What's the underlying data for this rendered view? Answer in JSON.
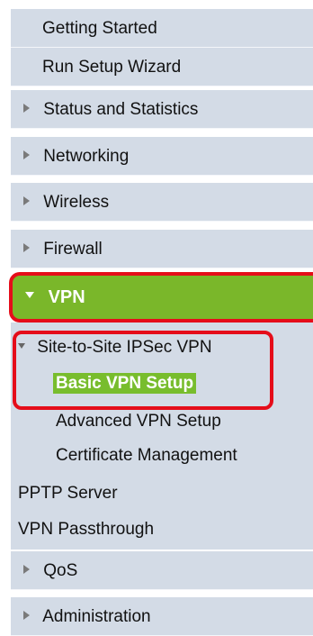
{
  "nav": {
    "items_top": [
      {
        "label": "Getting Started"
      },
      {
        "label": "Run Setup Wizard"
      },
      {
        "label": "Status and Statistics"
      },
      {
        "label": "Networking"
      },
      {
        "label": "Wireless"
      },
      {
        "label": "Firewall"
      }
    ],
    "vpn": {
      "label": "VPN",
      "children": {
        "site_to_site": "Site-to-Site IPSec VPN",
        "basic_vpn_setup": "Basic VPN Setup",
        "advanced_vpn_setup": "Advanced VPN Setup",
        "certificate_management": "Certificate Management",
        "pptp_server": "PPTP Server",
        "vpn_passthrough": "VPN Passthrough"
      }
    },
    "items_bottom": [
      {
        "label": "QoS"
      },
      {
        "label": "Administration"
      }
    ]
  },
  "colors": {
    "menu_bg": "#d3dbe6",
    "highlight_green": "#7ab72a",
    "annotation_red": "#e50d1a"
  }
}
